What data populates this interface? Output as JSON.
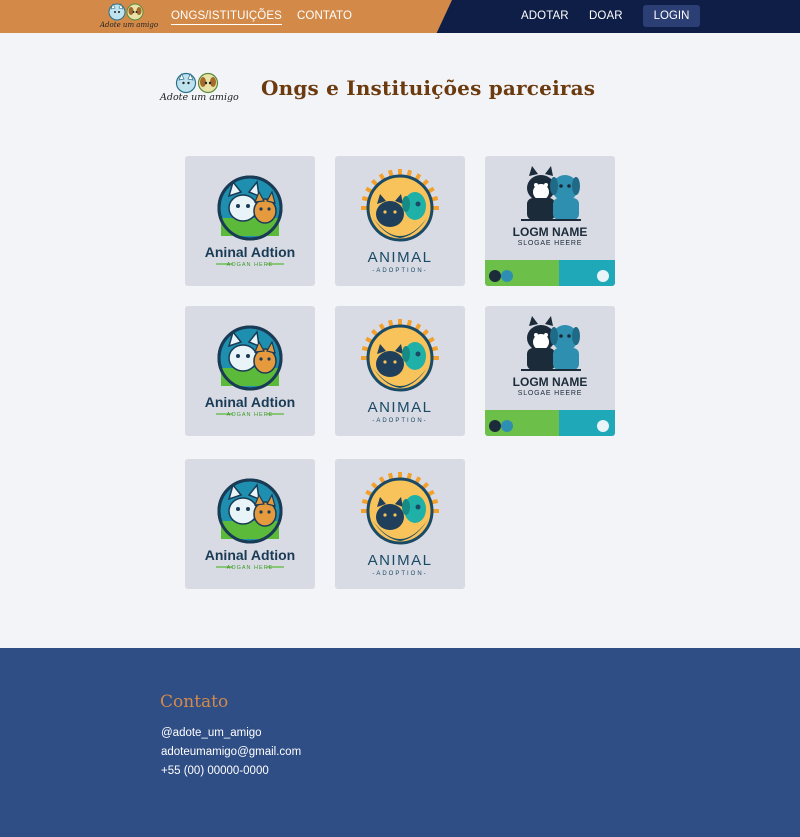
{
  "nav": {
    "brand_text": "Adote um amigo",
    "links": {
      "ongs": "ONGS/ISTITUIÇÕES",
      "contato": "CONTATO",
      "adotar": "ADOTAR",
      "doar": "DOAR"
    },
    "login_label": "LOGIN",
    "colors": {
      "left_band": "#d38a49",
      "right_band": "#0f1e46",
      "login_bg": "#2c3f74"
    }
  },
  "header": {
    "logo_text": "Adote um amigo",
    "title": "Ongs e Instituições parceiras"
  },
  "partners": [
    {
      "type": "badge",
      "name": "Aninal Adtion",
      "tagline": "AOGAN HERE"
    },
    {
      "type": "sun",
      "name": "ANIMAL",
      "tagline": "ADOPTION"
    },
    {
      "type": "logm",
      "name": "LOGM NAME",
      "tagline": "SLOGAE HEERE"
    },
    {
      "type": "badge",
      "name": "Aninal Adtion",
      "tagline": "AOGAN HERE"
    },
    {
      "type": "sun",
      "name": "ANIMAL",
      "tagline": "ADOPTION"
    },
    {
      "type": "logm",
      "name": "LOGM NAME",
      "tagline": "SLOGAE HEERE"
    },
    {
      "type": "badge",
      "name": "Aninal Adtion",
      "tagline": "AOGAN HERE"
    },
    {
      "type": "sun",
      "name": "ANIMAL",
      "tagline": "ADOPTION"
    }
  ],
  "footer": {
    "title": "Contato",
    "instagram": "@adote_um_amigo",
    "email": "adoteumamigo@gmail.com",
    "phone": "+55 (00) 00000-0000",
    "colors": {
      "background": "#304e86",
      "title": "#d38a49"
    }
  }
}
